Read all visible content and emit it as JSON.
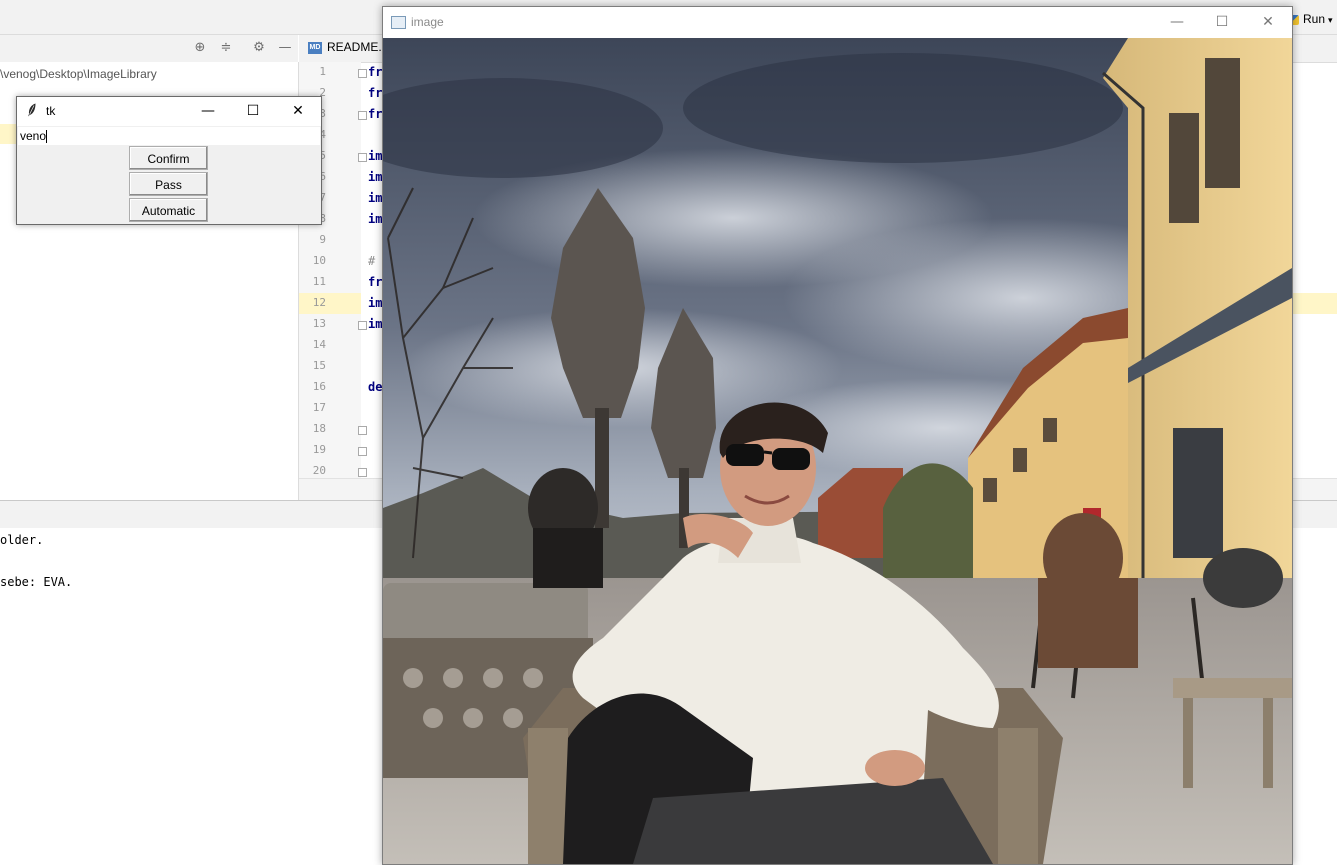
{
  "ide": {
    "project_path": "\\venog\\Desktop\\ImageLibrary",
    "readme_tab": "README.m",
    "md_badge": "MD",
    "run_label": "Run",
    "line_numbers": [
      "1",
      "2",
      "3",
      "4",
      "5",
      "6",
      "7",
      "8",
      "9",
      "10",
      "11",
      "12",
      "13",
      "14",
      "15",
      "16",
      "17",
      "18",
      "19",
      "20"
    ],
    "code_snippets": {
      "l1": "fr",
      "l2": "fr",
      "l3": "fr",
      "l5": "im",
      "l6": "im",
      "l7": "im",
      "l8": "im",
      "l10": "#",
      "l11": "fr",
      "l12": "im",
      "l13": "im",
      "l16": "de"
    },
    "console_lines": [
      "older.",
      "sebe: EVA."
    ]
  },
  "tk_window": {
    "title": "tk",
    "entry_value": "veno",
    "buttons": [
      "Confirm",
      "Pass",
      "Automatic"
    ],
    "minimize": "—",
    "maximize": "☐",
    "close": "✕"
  },
  "image_window": {
    "title": "image",
    "minimize": "—",
    "maximize": "☐",
    "close": "✕",
    "photo_description_colors": {
      "sky": "#5e6b80",
      "building": "#e9c98a",
      "sweater": "#efece4"
    }
  }
}
